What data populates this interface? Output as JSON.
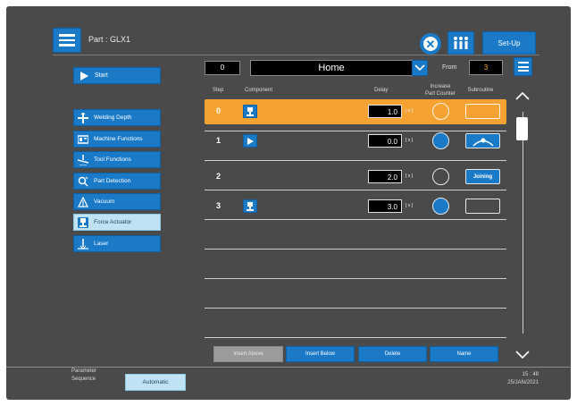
{
  "header": {
    "part_label": "Part : GLX1",
    "setup_label": "Set-Up"
  },
  "sidebar": {
    "start_label": "Start",
    "items": [
      {
        "label": "Welding Depth",
        "icon": "welding-depth-icon"
      },
      {
        "label": "Machine Functions",
        "icon": "machine-functions-icon"
      },
      {
        "label": "Tool Functions",
        "icon": "tool-functions-icon"
      },
      {
        "label": "Part Detection",
        "icon": "part-detection-icon"
      },
      {
        "label": "Vacuum",
        "icon": "vacuum-icon"
      },
      {
        "label": "Force Actuator",
        "icon": "force-actuator-icon",
        "active": true
      },
      {
        "label": "Laser",
        "icon": "laser-icon"
      }
    ]
  },
  "controls": {
    "step_value": "0",
    "title": "Home",
    "from_label": "From",
    "from_value": "3"
  },
  "columns": {
    "step": "Step",
    "component": "Component",
    "delay": "Delay",
    "increase_line1": "Increase",
    "increase_line2": "Part Counter",
    "subroutine": "Subroutine"
  },
  "rows": [
    {
      "step": "0",
      "component": "actuator-icon",
      "delay": "1.0",
      "unit": "[ s ]",
      "counter": false,
      "subroutine": "empty",
      "selected": true
    },
    {
      "step": "1",
      "component": "play-icon",
      "delay": "0.0",
      "unit": "[ s ]",
      "counter": true,
      "subroutine": "joining-curve-icon",
      "selected": false
    },
    {
      "step": "2",
      "component": "",
      "delay": "2.0",
      "unit": "[ s ]",
      "counter": false,
      "subroutine": "Joining",
      "selected": false
    },
    {
      "step": "3",
      "component": "actuator-icon",
      "delay": "3.0",
      "unit": "[ s ]",
      "counter": true,
      "subroutine": "empty",
      "selected": false
    }
  ],
  "actions": {
    "insert_above": "Insert Above",
    "insert_below": "Insert Below",
    "delete": "Delete",
    "name": "Name"
  },
  "footer": {
    "param_line1": "Parameter",
    "param_line2": "Sequence",
    "automatic_label": "Automatic",
    "time": "15 : 48",
    "date": "25/JAN/2021"
  },
  "colors": {
    "accent_blue": "#1a7ac8",
    "selected_row": "#f5a232",
    "background": "#4a4a4a"
  }
}
